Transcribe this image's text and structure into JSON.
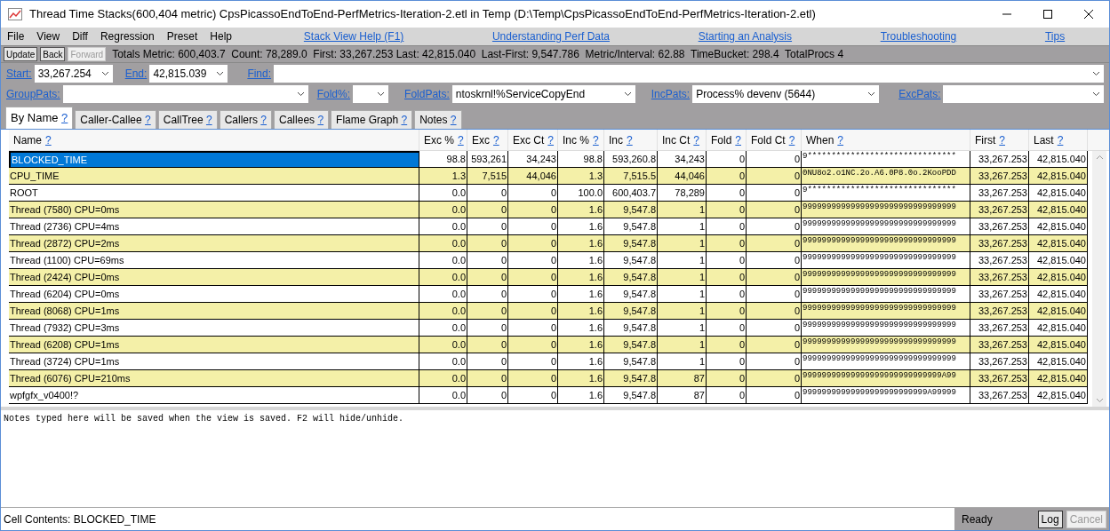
{
  "window": {
    "title": "Thread Time Stacks(600,404 metric) CpsPicassoEndToEnd-PerfMetrics-Iteration-2.etl in Temp (D:\\Temp\\CpsPicassoEndToEnd-PerfMetrics-Iteration-2.etl)"
  },
  "menu": [
    "File",
    "View",
    "Diff",
    "Regression",
    "Preset",
    "Help"
  ],
  "help_links": [
    "Stack View Help (F1)",
    "Understanding Perf Data",
    "Starting an Analysis",
    "Troubleshooting",
    "Tips"
  ],
  "toolbar": {
    "buttons": [
      {
        "label": "Update",
        "disabled": false
      },
      {
        "label": "Back",
        "disabled": false
      },
      {
        "label": "Forward",
        "disabled": true
      }
    ],
    "totals": "Totals Metric: 600,403.7  Count: 78,289.0  First: 33,267.253 Last: 42,815.040  Last-First: 9,547.786  Metric/Interval: 62.88  TimeBucket: 298.4  TotalProcs 4"
  },
  "filters": {
    "start": {
      "label": "Start:",
      "value": "33,267.254"
    },
    "end": {
      "label": "End:",
      "value": "42,815.039"
    },
    "find": {
      "label": "Find:"
    },
    "group_pats": {
      "label": "GroupPats:"
    },
    "fold_pct": {
      "label": "Fold%:"
    },
    "fold_pats": {
      "label": "FoldPats:",
      "value": "ntoskrnl!%ServiceCopyEnd"
    },
    "inc_pats": {
      "label": "IncPats:",
      "value": "Process% devenv (5644)"
    },
    "exc_pats": {
      "label": "ExcPats:"
    }
  },
  "tabs": [
    {
      "label": "By Name",
      "selected": true
    },
    {
      "label": "Caller-Callee",
      "selected": false
    },
    {
      "label": "CallTree",
      "selected": false
    },
    {
      "label": "Callers",
      "selected": false
    },
    {
      "label": "Callees",
      "selected": false
    },
    {
      "label": "Flame Graph",
      "selected": false
    },
    {
      "label": "Notes",
      "selected": false
    }
  ],
  "help_mark": "?",
  "table": {
    "columns": [
      "Name",
      "Exc %",
      "Exc",
      "Exc Ct",
      "Inc %",
      "Inc",
      "Inc Ct",
      "Fold",
      "Fold Ct",
      "When",
      "First",
      "Last"
    ],
    "rows": [
      {
        "selected": true,
        "cells": [
          "BLOCKED_TIME",
          "98.8",
          "593,261",
          "34,243",
          "98.8",
          "593,260.8",
          "34,243",
          "0",
          "0",
          "9*******************************",
          "33,267.253",
          "42,815.040"
        ]
      },
      {
        "selected": false,
        "cells": [
          "CPU_TIME",
          "1.3",
          "7,515",
          "44,046",
          "1.3",
          "7,515.5",
          "44,046",
          "0",
          "0",
          "0NU8o2.o1NC.2o.A6.0P8.0o.2KooPDD",
          "33,267.253",
          "42,815.040"
        ]
      },
      {
        "selected": false,
        "cells": [
          "ROOT",
          "0.0",
          "0",
          "0",
          "100.0",
          "600,403.7",
          "78,289",
          "0",
          "0",
          "9*******************************",
          "33,267.253",
          "42,815.040"
        ]
      },
      {
        "selected": false,
        "cells": [
          "Thread (7580) CPU=0ms",
          "0.0",
          "0",
          "0",
          "1.6",
          "9,547.8",
          "1",
          "0",
          "0",
          "99999999999999999999999999999999",
          "33,267.253",
          "42,815.040"
        ]
      },
      {
        "selected": false,
        "cells": [
          "Thread (2736) CPU=4ms",
          "0.0",
          "0",
          "0",
          "1.6",
          "9,547.8",
          "1",
          "0",
          "0",
          "99999999999999999999999999999999",
          "33,267.253",
          "42,815.040"
        ]
      },
      {
        "selected": false,
        "cells": [
          "Thread (2872) CPU=2ms",
          "0.0",
          "0",
          "0",
          "1.6",
          "9,547.8",
          "1",
          "0",
          "0",
          "99999999999999999999999999999999",
          "33,267.253",
          "42,815.040"
        ]
      },
      {
        "selected": false,
        "cells": [
          "Thread (1100) CPU=69ms",
          "0.0",
          "0",
          "0",
          "1.6",
          "9,547.8",
          "1",
          "0",
          "0",
          "99999999999999999999999999999999",
          "33,267.253",
          "42,815.040"
        ]
      },
      {
        "selected": false,
        "cells": [
          "Thread (2424) CPU=0ms",
          "0.0",
          "0",
          "0",
          "1.6",
          "9,547.8",
          "1",
          "0",
          "0",
          "99999999999999999999999999999999",
          "33,267.253",
          "42,815.040"
        ]
      },
      {
        "selected": false,
        "cells": [
          "Thread (6204) CPU=0ms",
          "0.0",
          "0",
          "0",
          "1.6",
          "9,547.8",
          "1",
          "0",
          "0",
          "99999999999999999999999999999999",
          "33,267.253",
          "42,815.040"
        ]
      },
      {
        "selected": false,
        "cells": [
          "Thread (8068) CPU=1ms",
          "0.0",
          "0",
          "0",
          "1.6",
          "9,547.8",
          "1",
          "0",
          "0",
          "99999999999999999999999999999999",
          "33,267.253",
          "42,815.040"
        ]
      },
      {
        "selected": false,
        "cells": [
          "Thread (7932) CPU=3ms",
          "0.0",
          "0",
          "0",
          "1.6",
          "9,547.8",
          "1",
          "0",
          "0",
          "99999999999999999999999999999999",
          "33,267.253",
          "42,815.040"
        ]
      },
      {
        "selected": false,
        "cells": [
          "Thread (6208) CPU=1ms",
          "0.0",
          "0",
          "0",
          "1.6",
          "9,547.8",
          "1",
          "0",
          "0",
          "99999999999999999999999999999999",
          "33,267.253",
          "42,815.040"
        ]
      },
      {
        "selected": false,
        "cells": [
          "Thread (3724) CPU=1ms",
          "0.0",
          "0",
          "0",
          "1.6",
          "9,547.8",
          "1",
          "0",
          "0",
          "99999999999999999999999999999999",
          "33,267.253",
          "42,815.040"
        ]
      },
      {
        "selected": false,
        "cells": [
          "Thread (6076) CPU=210ms",
          "0.0",
          "0",
          "0",
          "1.6",
          "9,547.8",
          "87",
          "0",
          "0",
          "99999999999999999999999999999A99",
          "33,267.253",
          "42,815.040"
        ]
      },
      {
        "selected": false,
        "cells": [
          "wpfgfx_v0400!?",
          "0.0",
          "0",
          "0",
          "1.6",
          "9,547.8",
          "87",
          "0",
          "0",
          "99999999999999999999999999A99999",
          "33,267.253",
          "42,815.040"
        ]
      }
    ]
  },
  "notes": "Notes typed here will be saved when the view is saved. F2 will hide/unhide.",
  "status": {
    "cell_contents": "Cell Contents: BLOCKED_TIME",
    "state": "Ready",
    "buttons": [
      {
        "label": "Log",
        "disabled": false
      },
      {
        "label": "Cancel",
        "disabled": true
      }
    ]
  }
}
